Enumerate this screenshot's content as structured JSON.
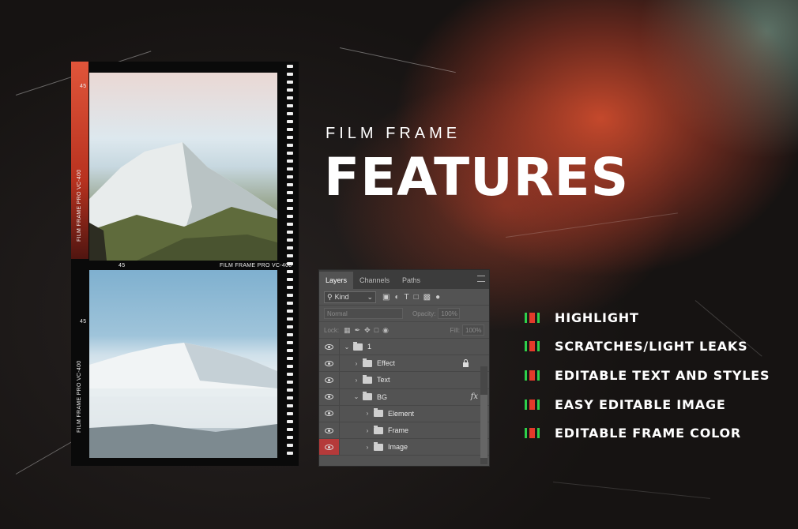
{
  "title": {
    "kicker": "FILM FRAME",
    "headline": "FEATURES"
  },
  "film": {
    "frame_label": "FILM FRAME PRO VC-400",
    "frame_number": "45"
  },
  "layers_panel": {
    "tabs": [
      "Layers",
      "Channels",
      "Paths"
    ],
    "filter_kind": "Kind",
    "blend_mode": "Normal",
    "opacity_label": "Opacity:",
    "opacity_value": "100%",
    "lock_label": "Lock:",
    "fill_label": "Fill:",
    "fill_value": "100%",
    "layers": [
      {
        "name": "1"
      },
      {
        "name": "Effect"
      },
      {
        "name": "Text"
      },
      {
        "name": "BG"
      },
      {
        "name": "Element"
      },
      {
        "name": "Frame"
      },
      {
        "name": "Image"
      }
    ],
    "fx_label": "fx"
  },
  "features": [
    "HIGHLIGHT",
    "SCRATCHES/LIGHT LEAKS",
    "EDITABLE TEXT AND STYLES",
    "EASY EDITABLE IMAGE",
    "EDITABLE FRAME COLOR"
  ],
  "colors": {
    "marker_green": "#2ed04a",
    "marker_red": "#e33a2a",
    "light_leak": "#cd4b2d",
    "selected_eye": "#b53a3a"
  }
}
